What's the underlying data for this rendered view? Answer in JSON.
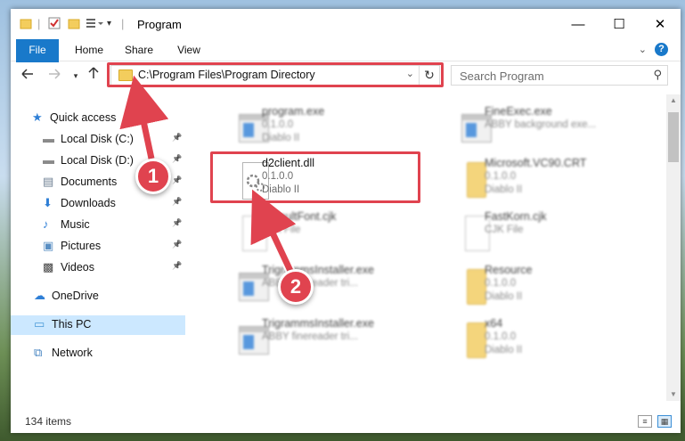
{
  "window": {
    "title": "Program",
    "controls": {
      "minimize": "—",
      "maximize": "☐",
      "close": "✕"
    }
  },
  "ribbon": {
    "tabs": [
      "File",
      "Home",
      "Share",
      "View"
    ],
    "help": "?"
  },
  "address": {
    "path": "C:\\Program Files\\Program Directory",
    "search_placeholder": "Search Program"
  },
  "nav": {
    "items": [
      {
        "label": "Quick access",
        "icon": "star-icon"
      },
      {
        "label": "Local Disk (C:)",
        "icon": "drive-icon",
        "pinned": true
      },
      {
        "label": "Local Disk (D:)",
        "icon": "drive-icon",
        "pinned": true
      },
      {
        "label": "Documents",
        "icon": "documents-icon",
        "pinned": true
      },
      {
        "label": "Downloads",
        "icon": "download-icon",
        "pinned": true
      },
      {
        "label": "Music",
        "icon": "music-icon",
        "pinned": true
      },
      {
        "label": "Pictures",
        "icon": "pictures-icon",
        "pinned": true
      },
      {
        "label": "Videos",
        "icon": "videos-icon",
        "pinned": true
      },
      {
        "label": "OneDrive",
        "icon": "cloud-icon"
      },
      {
        "label": "This PC",
        "icon": "pc-icon",
        "selected": true
      },
      {
        "label": "Network",
        "icon": "network-icon"
      }
    ]
  },
  "files": [
    {
      "name": "program.exe",
      "line2": "0.1.0.0",
      "line3": "Diablo II",
      "type": "exe"
    },
    {
      "name": "FineExec.exe",
      "line2": "ABBY background exe...",
      "line3": "",
      "type": "exe"
    },
    {
      "name": "d2client.dll",
      "line2": "0.1.0.0",
      "line3": "Diablo II",
      "type": "dll",
      "highlighted": true
    },
    {
      "name": "Microsoft.VC90.CRT",
      "line2": "0.1.0.0",
      "line3": "Diablo II",
      "type": "folder"
    },
    {
      "name": "DefaultFont.cjk",
      "line2": "CJK File",
      "line3": "",
      "type": "doc"
    },
    {
      "name": "FastKorn.cjk",
      "line2": "CJK File",
      "line3": "",
      "type": "doc"
    },
    {
      "name": "TrigrammsInstaller.exe",
      "line2": "ABBY finereader tri...",
      "line3": "",
      "type": "exe"
    },
    {
      "name": "Resource",
      "line2": "0.1.0.0",
      "line3": "Diablo II",
      "type": "folder"
    },
    {
      "name": "TrigrammsInstaller.exe",
      "line2": "ABBY finereader tri...",
      "line3": "",
      "type": "exe"
    },
    {
      "name": "x64",
      "line2": "0.1.0.0",
      "line3": "Diablo II",
      "type": "folder"
    }
  ],
  "status": {
    "count": "134 items"
  },
  "annotations": {
    "step1": "1",
    "step2": "2"
  },
  "colors": {
    "accent": "#1979ca",
    "highlight": "#e0434f",
    "selected": "#cce8ff"
  }
}
